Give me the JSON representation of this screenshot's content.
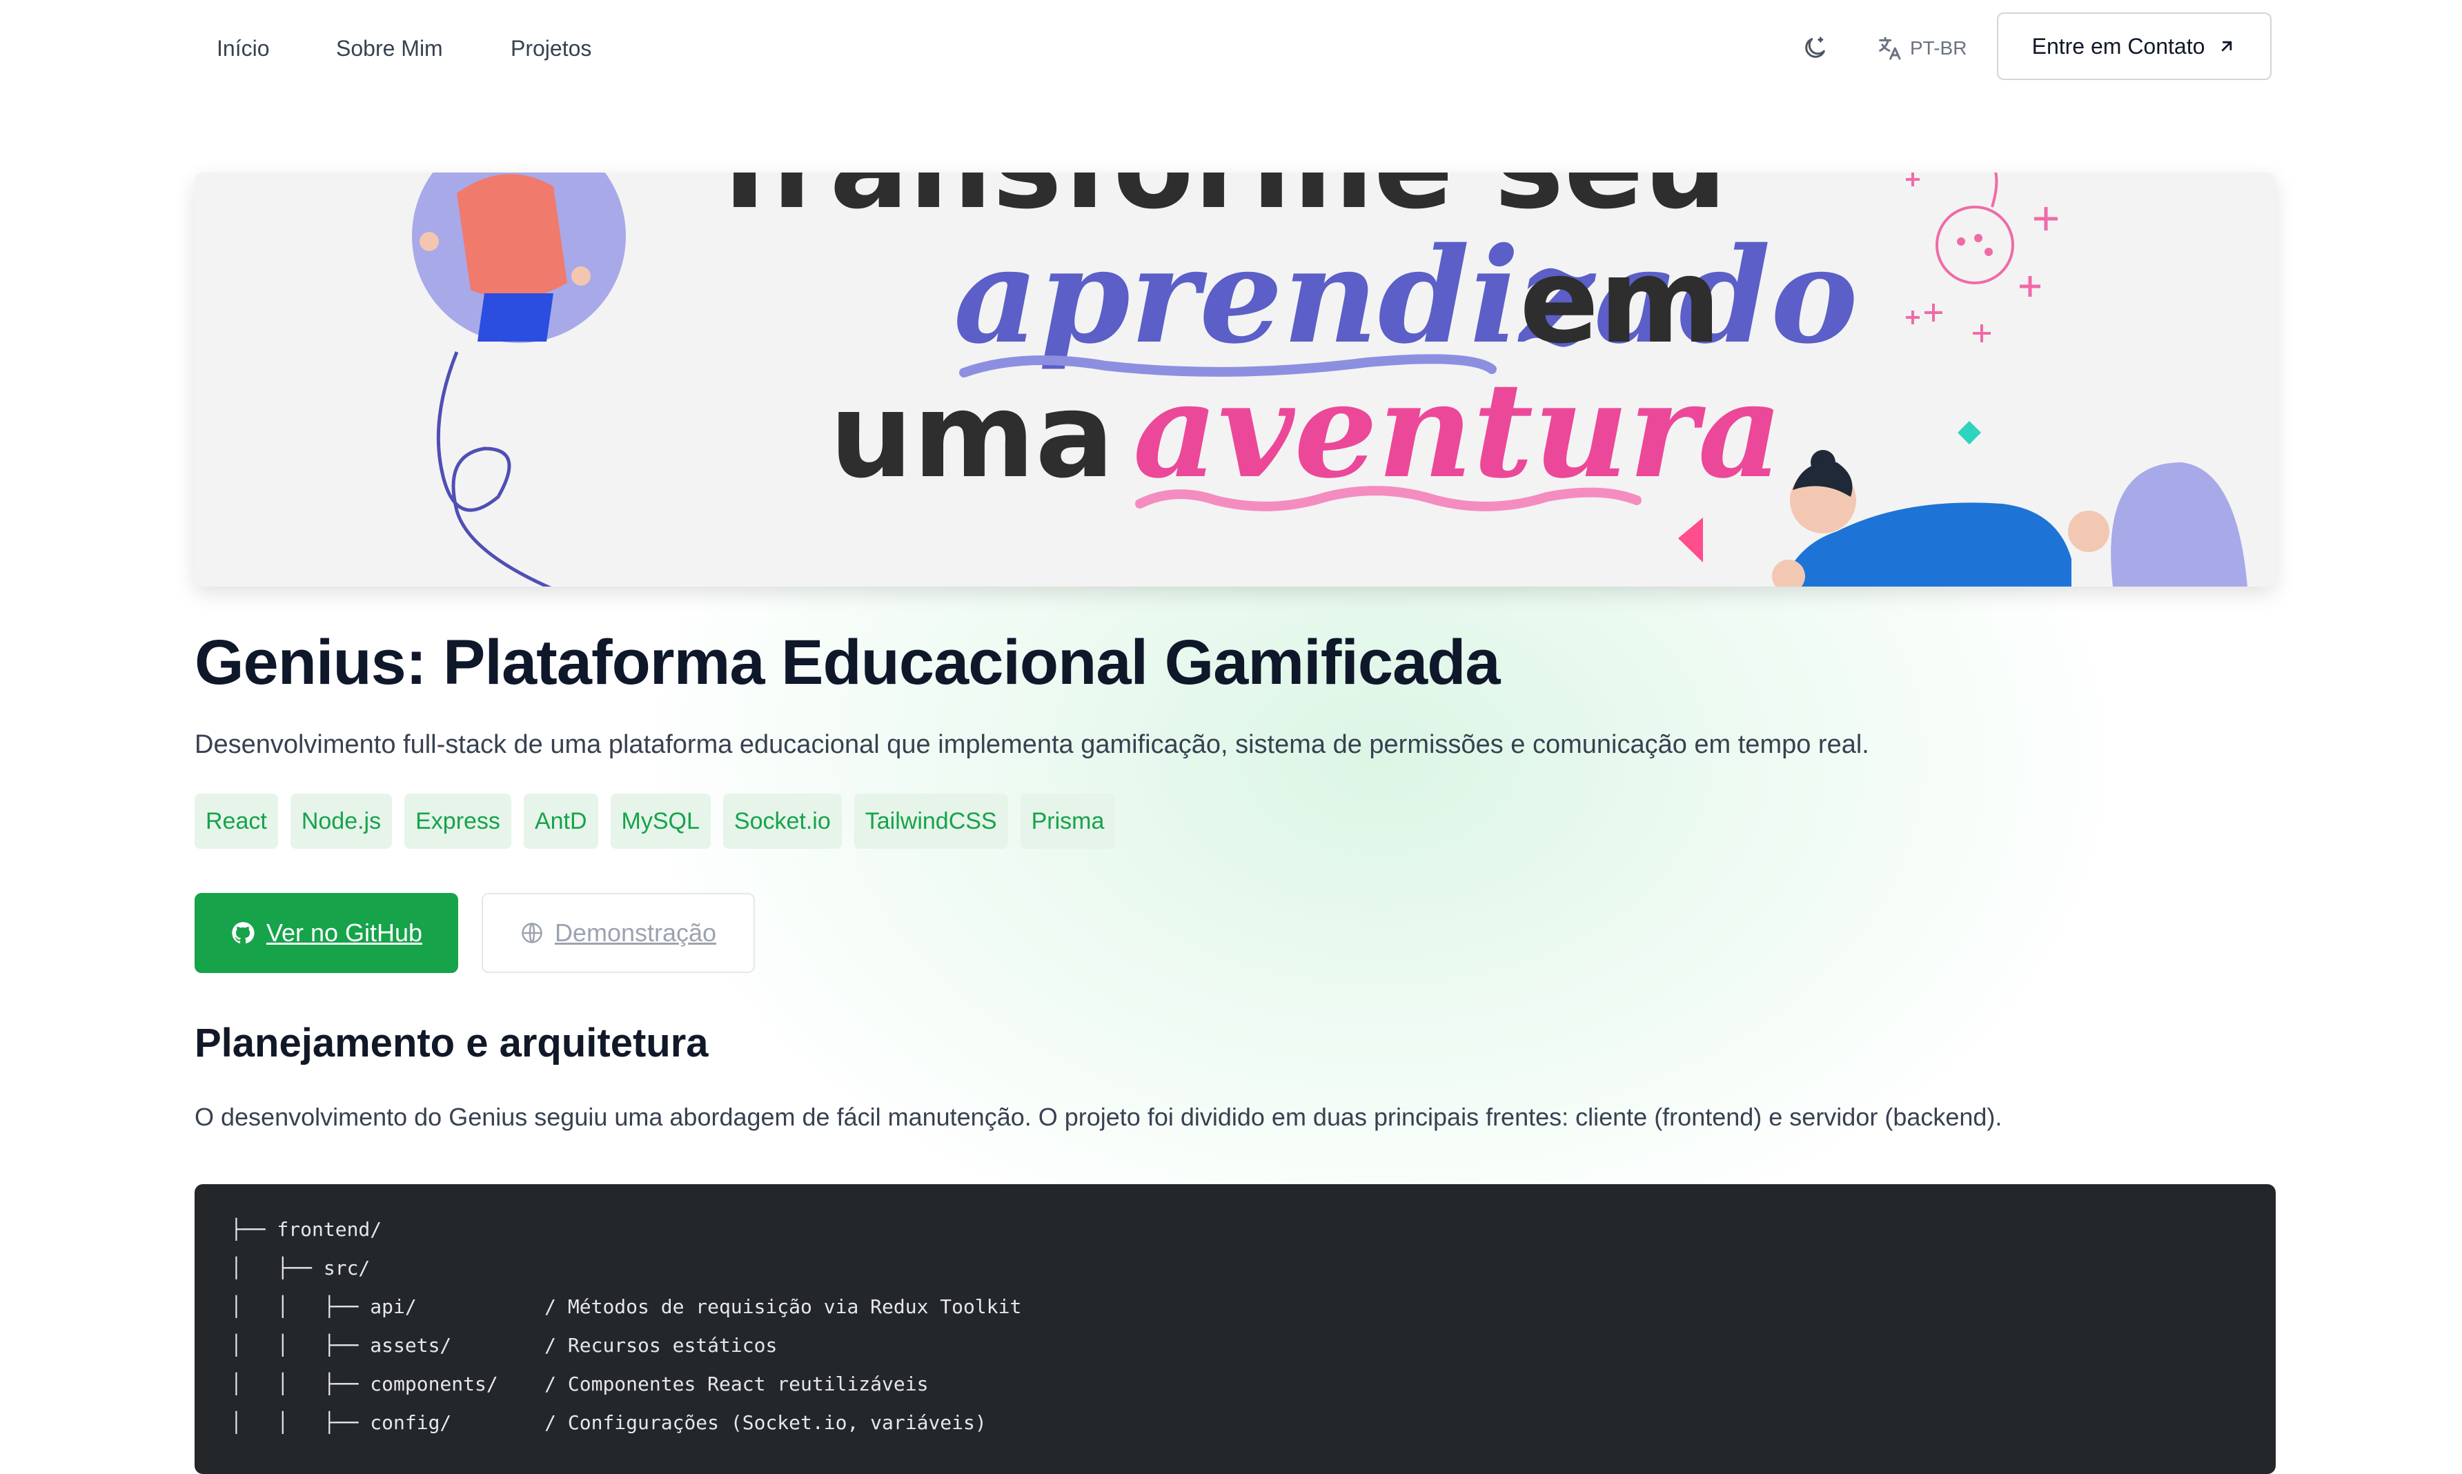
{
  "nav": {
    "links": [
      "Início",
      "Sobre Mim",
      "Projetos"
    ],
    "theme_icon": "moon-icon",
    "language": "PT-BR",
    "language_icon": "translate-icon",
    "contact_label": "Entre em Contato",
    "contact_icon": "arrow-up-right-icon"
  },
  "banner": {
    "line1": "Transforme seu",
    "word_highlight1": "aprendizado",
    "word_em": "em",
    "word_uma": "uma",
    "word_highlight2": "aventura"
  },
  "project": {
    "title": "Genius: Plataforma Educacional Gamificada",
    "subtitle": "Desenvolvimento full-stack de uma plataforma educacional que implementa gamificação, sistema de permissões e comunicação em tempo real.",
    "tags": [
      "React",
      "Node.js",
      "Express",
      "AntD",
      "MySQL",
      "Socket.io",
      "TailwindCSS",
      "Prisma"
    ],
    "github_label": "Ver no GitHub",
    "github_icon": "github-icon",
    "demo_label": "Demonstração",
    "demo_icon": "globe-icon"
  },
  "section": {
    "heading": "Planejamento e arquitetura",
    "paragraph": "O desenvolvimento do Genius seguiu uma abordagem de fácil manutenção. O projeto foi dividido em duas principais frentes: cliente (frontend) e servidor (backend)."
  },
  "code_lines": [
    "├── frontend/",
    "│   ├── src/",
    "│   │   ├── api/           / Métodos de requisição via Redux Toolkit",
    "│   │   ├── assets/        / Recursos estáticos",
    "│   │   ├── components/    / Componentes React reutilizáveis",
    "│   │   ├── config/        / Configurações (Socket.io, variáveis)"
  ],
  "colors": {
    "accent": "#16a34a",
    "tag_bg": "#e6f4ea",
    "code_bg": "#23272a",
    "highlight_purple": "#5b5fc7",
    "highlight_pink": "#ec4899"
  }
}
